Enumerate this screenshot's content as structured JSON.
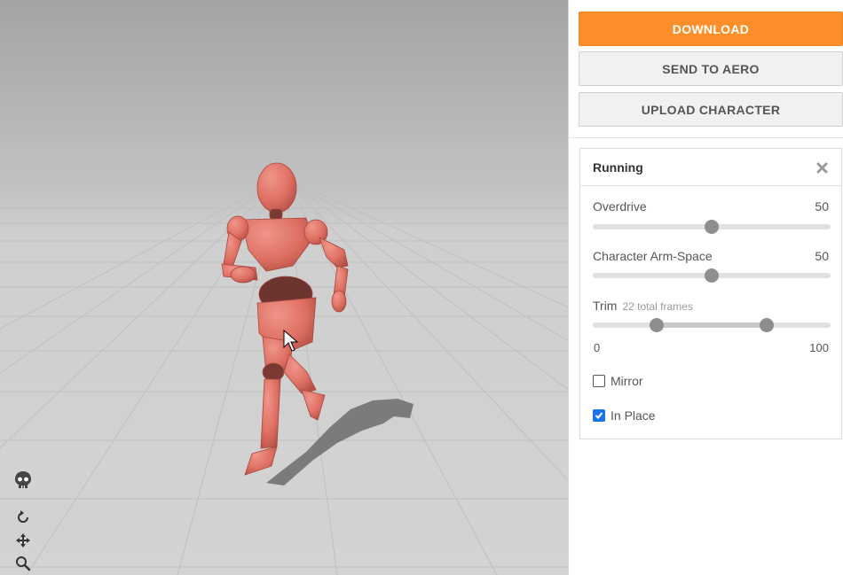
{
  "viewport": {
    "tools": [
      {
        "name": "skeleton-icon"
      },
      {
        "name": "reset-view-icon"
      },
      {
        "name": "pan-icon"
      },
      {
        "name": "zoom-icon"
      }
    ]
  },
  "actions": {
    "download_label": "DOWNLOAD",
    "send_label": "SEND TO AERO",
    "upload_label": "UPLOAD CHARACTER"
  },
  "animation": {
    "title": "Running",
    "overdrive": {
      "label": "Overdrive",
      "value": "50",
      "fraction": 0.5
    },
    "arm_space": {
      "label": "Character Arm-Space",
      "value": "50",
      "fraction": 0.5
    },
    "trim": {
      "label": "Trim",
      "sub": "22 total frames",
      "min_label": "0",
      "max_label": "100",
      "start_fraction": 0.27,
      "end_fraction": 0.73
    },
    "mirror": {
      "label": "Mirror",
      "checked": false
    },
    "in_place": {
      "label": "In Place",
      "checked": true
    }
  },
  "colors": {
    "primary": "#fd8f2b",
    "character": "#e07468",
    "checkbox": "#1a73e8"
  }
}
